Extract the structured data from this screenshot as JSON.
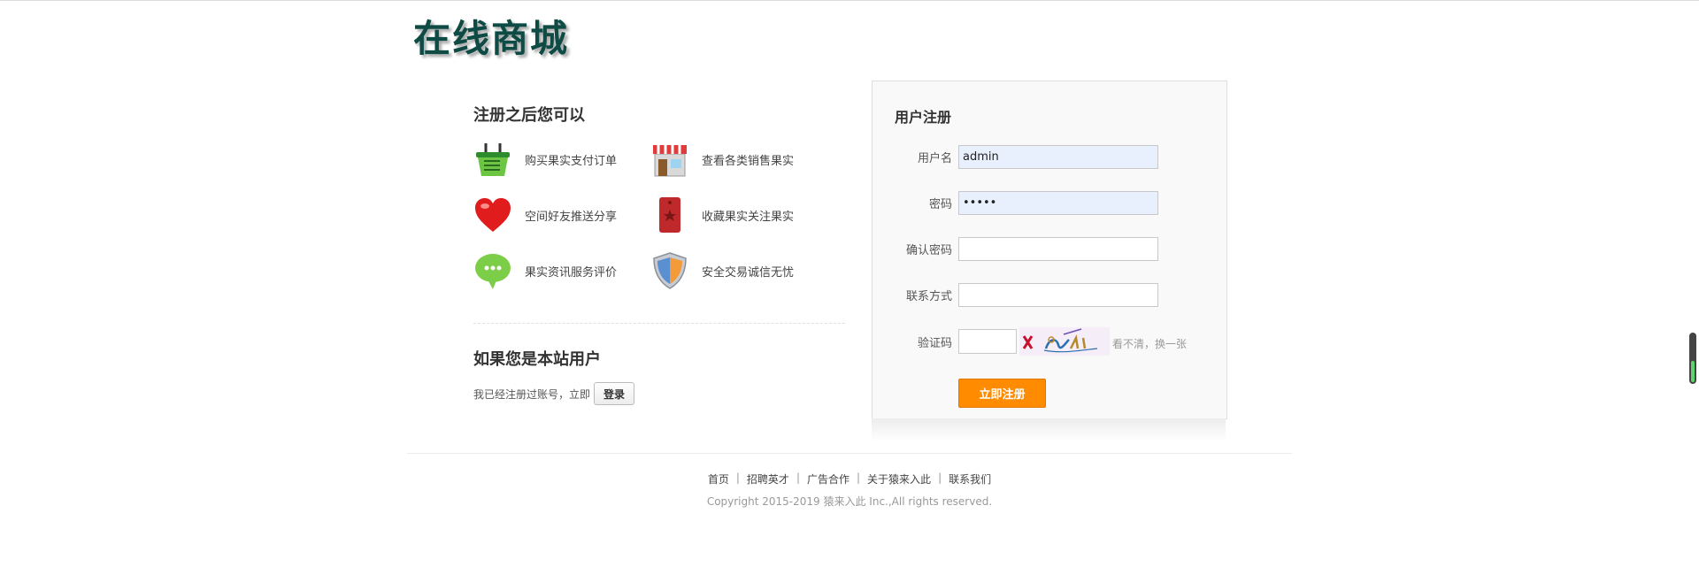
{
  "brand": {
    "logo_text": "在线商城"
  },
  "intro": {
    "title": "注册之后您可以",
    "features": [
      {
        "label": "购买果实支付订单",
        "icon": "basket-icon"
      },
      {
        "label": "查看各类销售果实",
        "icon": "shop-icon"
      },
      {
        "label": "空间好友推送分享",
        "icon": "heart-icon"
      },
      {
        "label": "收藏果实关注果实",
        "icon": "bookmark-icon"
      },
      {
        "label": "果实资讯服务评价",
        "icon": "chat-bubble-icon"
      },
      {
        "label": "安全交易诚信无忧",
        "icon": "shield-icon"
      }
    ]
  },
  "member": {
    "title": "如果您是本站用户",
    "text": "我已经注册过账号，立即",
    "login_label": "登录"
  },
  "form": {
    "title": "用户注册",
    "username_label": "用户名",
    "username_value": "admin",
    "password_label": "密码",
    "password_value": "•••••",
    "confirm_label": "确认密码",
    "contact_label": "联系方式",
    "captcha_label": "验证码",
    "captcha_refresh": "看不清，换一张",
    "submit_label": "立即注册"
  },
  "footer": {
    "links": [
      "首页",
      "招聘英才",
      "广告合作",
      "关于猿来入此",
      "联系我们"
    ],
    "copyright": "Copyright 2015-2019 猿来入此 Inc.,All rights reserved."
  },
  "colors": {
    "accent": "#ff8c00",
    "logo": "#0f4b45",
    "input_autofill": "#e8f0fe"
  }
}
